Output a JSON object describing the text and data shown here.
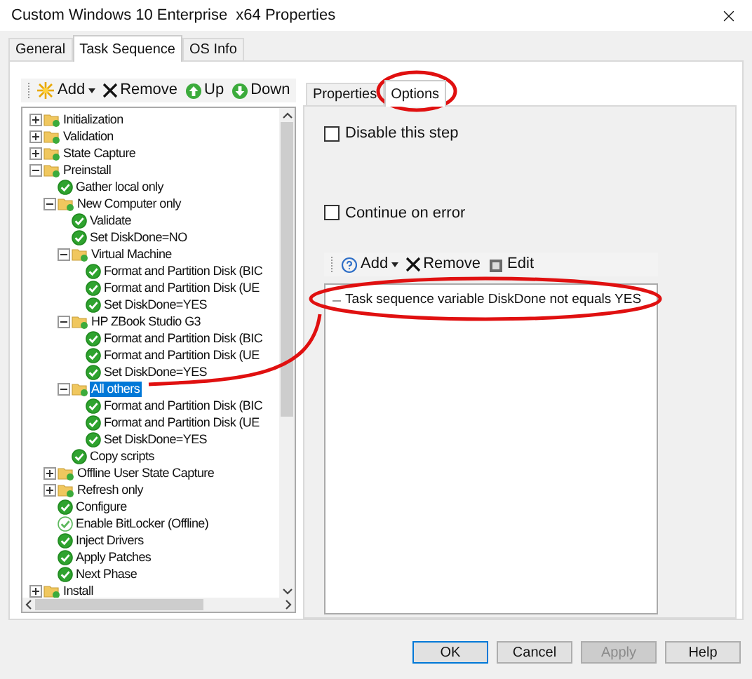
{
  "window": {
    "title": "Custom Windows 10 Enterprise  x64 Properties"
  },
  "tabs": [
    {
      "label": "General",
      "selected": false
    },
    {
      "label": "Task Sequence",
      "selected": true
    },
    {
      "label": "OS Info",
      "selected": false
    }
  ],
  "toolbar": [
    {
      "kind": "add",
      "label": "Add"
    },
    {
      "kind": "remove",
      "label": "Remove"
    },
    {
      "kind": "up",
      "label": "Up"
    },
    {
      "kind": "down",
      "label": "Down"
    }
  ],
  "tree": [
    {
      "kind": "group",
      "name": "Initialization",
      "expanded": false,
      "selected": false
    },
    {
      "kind": "group",
      "name": "Validation",
      "expanded": false,
      "selected": false
    },
    {
      "kind": "group",
      "name": "State Capture",
      "expanded": false,
      "selected": false
    },
    {
      "kind": "group",
      "name": "Preinstall",
      "expanded": true,
      "selected": false,
      "children": [
        {
          "kind": "step",
          "name": "Gather local only",
          "disabled": false,
          "selected": false
        },
        {
          "kind": "group",
          "name": "New Computer only",
          "expanded": true,
          "selected": false,
          "children": [
            {
              "kind": "step",
              "name": "Validate",
              "disabled": false,
              "selected": false
            },
            {
              "kind": "step",
              "name": "Set DiskDone=NO",
              "disabled": false,
              "selected": false
            },
            {
              "kind": "group",
              "name": "Virtual Machine",
              "expanded": true,
              "selected": false,
              "children": [
                {
                  "kind": "step",
                  "name": "Format and Partition Disk (BIC",
                  "disabled": false,
                  "selected": false
                },
                {
                  "kind": "step",
                  "name": "Format and Partition Disk (UE",
                  "disabled": false,
                  "selected": false
                },
                {
                  "kind": "step",
                  "name": "Set DiskDone=YES",
                  "disabled": false,
                  "selected": false
                }
              ]
            },
            {
              "kind": "group",
              "name": "HP ZBook Studio G3",
              "expanded": true,
              "selected": false,
              "children": [
                {
                  "kind": "step",
                  "name": "Format and Partition Disk (BIC",
                  "disabled": false,
                  "selected": false
                },
                {
                  "kind": "step",
                  "name": "Format and Partition Disk (UE",
                  "disabled": false,
                  "selected": false
                },
                {
                  "kind": "step",
                  "name": "Set DiskDone=YES",
                  "disabled": false,
                  "selected": false
                }
              ]
            },
            {
              "kind": "group",
              "name": "All others",
              "expanded": true,
              "selected": true,
              "children": [
                {
                  "kind": "step",
                  "name": "Format and Partition Disk (BIC",
                  "disabled": false,
                  "selected": false
                },
                {
                  "kind": "step",
                  "name": "Format and Partition Disk (UE",
                  "disabled": false,
                  "selected": false
                },
                {
                  "kind": "step",
                  "name": "Set DiskDone=YES",
                  "disabled": false,
                  "selected": false
                }
              ]
            },
            {
              "kind": "step",
              "name": "Copy scripts",
              "disabled": false,
              "selected": false
            }
          ]
        },
        {
          "kind": "group",
          "name": "Offline User State Capture",
          "expanded": false,
          "selected": false
        },
        {
          "kind": "group",
          "name": "Refresh only",
          "expanded": false,
          "selected": false
        },
        {
          "kind": "step",
          "name": "Configure",
          "disabled": false,
          "selected": false
        },
        {
          "kind": "step",
          "name": "Enable BitLocker (Offline)",
          "disabled": true,
          "selected": false
        },
        {
          "kind": "step",
          "name": "Inject Drivers",
          "disabled": false,
          "selected": false
        },
        {
          "kind": "step",
          "name": "Apply Patches",
          "disabled": false,
          "selected": false
        },
        {
          "kind": "step",
          "name": "Next Phase",
          "disabled": false,
          "selected": false
        }
      ]
    },
    {
      "kind": "group",
      "name": "Install",
      "expanded": false,
      "selected": false
    }
  ],
  "step_tabs": [
    {
      "label": "Properties",
      "selected": false
    },
    {
      "label": "Options",
      "selected": true
    }
  ],
  "options": [
    {
      "label": "Disable this step",
      "checked": false
    },
    {
      "label": "Continue on error",
      "checked": false
    }
  ],
  "condition_toolbar": [
    {
      "kind": "add",
      "label": "Add"
    },
    {
      "kind": "remove",
      "label": "Remove"
    },
    {
      "kind": "edit",
      "label": "Edit"
    }
  ],
  "conditions": [
    "Task sequence variable DiskDone not equals YES"
  ],
  "buttons": [
    {
      "label": "OK",
      "default": true,
      "disabled": false
    },
    {
      "label": "Cancel",
      "default": false,
      "disabled": false
    },
    {
      "label": "Apply",
      "default": false,
      "disabled": true
    },
    {
      "label": "Help",
      "default": false,
      "disabled": false
    }
  ]
}
